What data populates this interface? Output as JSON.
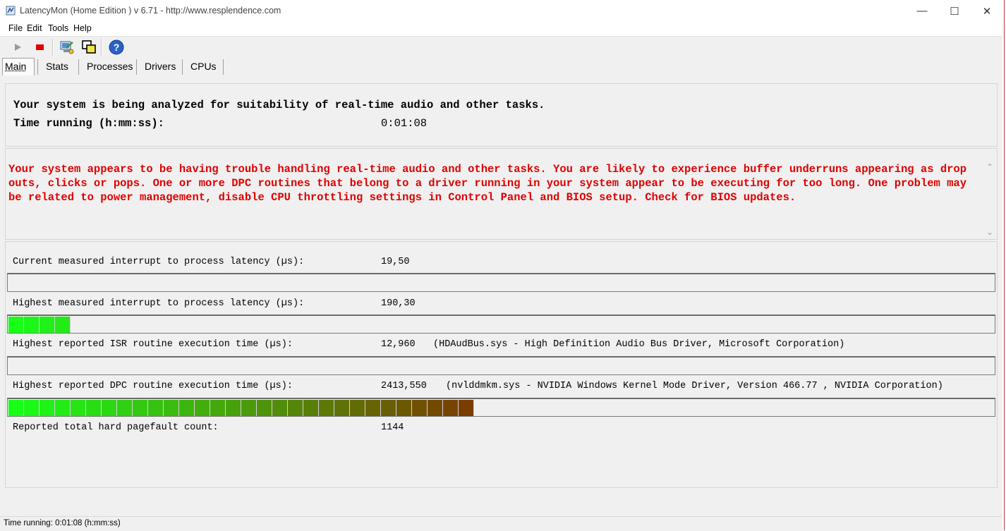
{
  "window": {
    "title": "LatencyMon  (Home Edition )  v 6.71 - http://www.resplendence.com",
    "minimize_glyph": "—",
    "maximize_glyph": "☐",
    "close_glyph": "✕"
  },
  "menu": {
    "file": "File",
    "edit": "Edit",
    "tools": "Tools",
    "help": "Help"
  },
  "toolbar": {
    "icons": [
      "play-icon",
      "stop-icon",
      "computer-check-icon",
      "windows-icon",
      "help-icon"
    ],
    "help_glyph": "?"
  },
  "tabs": [
    {
      "label": "Main",
      "selected": true
    },
    {
      "label": "Stats",
      "selected": false
    },
    {
      "label": "Processes",
      "selected": false
    },
    {
      "label": "Drivers",
      "selected": false
    },
    {
      "label": "CPUs",
      "selected": false
    }
  ],
  "main": {
    "analysis_line": "Your system is being analyzed for suitability of real-time audio and other tasks.",
    "time_label": "Time running (h:mm:ss):",
    "time_value": "0:01:08",
    "conclusion": "Your system appears to be having trouble handling real-time audio and other tasks. You are likely to experience buffer underruns appearing as drop outs, clicks or pops. One or more DPC routines that belong to a driver running in your system appear to be executing for too long. One problem may be related to power management, disable CPU throttling settings in Control Panel and BIOS setup. Check for BIOS updates.",
    "conclusion_color": "#e00000",
    "scroll_up_glyph": "⌃",
    "scroll_down_glyph": "⌄",
    "metrics": [
      {
        "label": "Current measured interrupt to process latency (µs):",
        "value": "19,50",
        "detail": "",
        "bar_segments": 0
      },
      {
        "label": "Highest measured interrupt to process latency (µs):",
        "value": "190,30",
        "detail": "",
        "bar_segments": 4
      },
      {
        "label": "Highest reported ISR routine execution time (µs):",
        "value": "12,960",
        "detail": "(HDAudBus.sys - High Definition Audio Bus Driver, Microsoft Corporation)",
        "bar_segments": 0
      },
      {
        "label": "Highest reported DPC routine execution time (µs):",
        "value": "2413,550",
        "detail": "(nvlddmkm.sys - NVIDIA Windows Kernel Mode Driver, Version 466.77 , NVIDIA Corporation)",
        "bar_segments": 30
      },
      {
        "label": "Reported total hard pagefault count:",
        "value": "1144",
        "detail": ""
      }
    ],
    "bar_color_start": "#18ff18",
    "bar_color_end": "#7a3c00"
  },
  "status": {
    "text": "Time running: 0:01:08  (h:mm:ss)"
  }
}
